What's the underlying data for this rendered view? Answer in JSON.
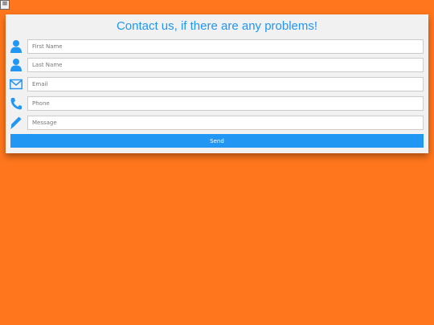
{
  "menu": {
    "glyph": "≡"
  },
  "form": {
    "title": "Contact us, if there are any problems!",
    "fields": [
      {
        "placeholder": "First Name",
        "icon": "user-icon"
      },
      {
        "placeholder": "Last Name",
        "icon": "user-icon"
      },
      {
        "placeholder": "Email",
        "icon": "envelope-icon"
      },
      {
        "placeholder": "Phone",
        "icon": "phone-icon"
      },
      {
        "placeholder": "Message",
        "icon": "pencil-icon"
      }
    ],
    "send_label": "Send"
  },
  "colors": {
    "background": "#ff761d",
    "accent": "#2196f3",
    "card": "#f1f1f1"
  }
}
